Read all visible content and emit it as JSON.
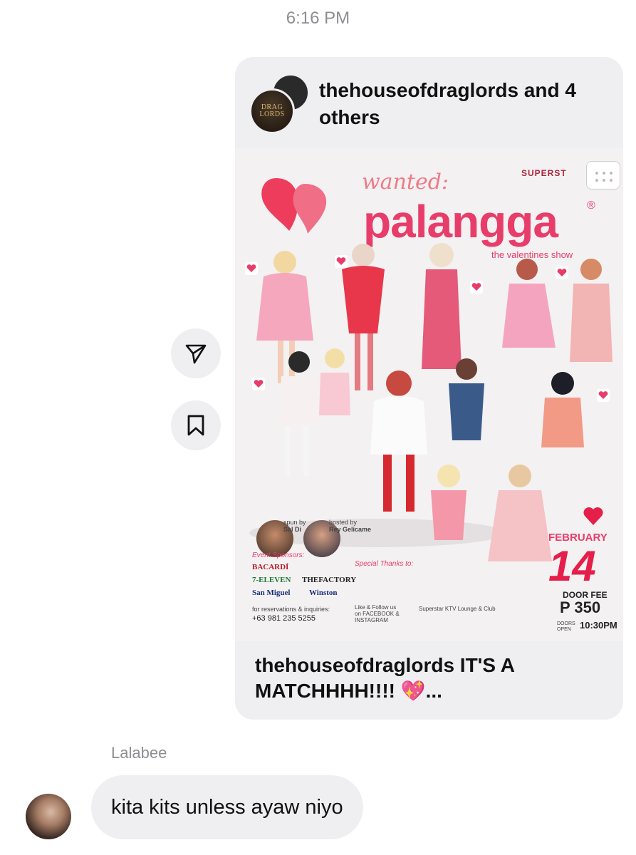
{
  "timestamp": "6:16 PM",
  "post": {
    "author_line": "thehouseofdraglords and 4 others",
    "avatar_text": [
      "DRAG",
      "LORDS"
    ],
    "caption": "thehouseofdraglords IT'S A MATCHHHH!!!! 💖...",
    "poster": {
      "wanted": "wanted:",
      "title": "palangga",
      "reg": "®",
      "subtitle": "the valentines show",
      "venue": "SUPERST",
      "spun_by_label": "spun by",
      "spun_by": "Sal Di",
      "hosted_by_label": "hosted by",
      "hosted_by": "Rey Gelicame",
      "event_sponsors_label": "Event Sponsors:",
      "sponsors": [
        "BACARDÍ",
        "7-ELEVEN",
        "THEFACTORY",
        "San Miguel",
        "Winston"
      ],
      "special_thanks_label": "Special Thanks to:",
      "reservations_label": "for reservations & inquiries:",
      "phone": "+63 981 235 5255",
      "follow_text": "Like & Follow us on FACEBOOK & INSTAGRAM",
      "club_name": "Superstar KTV Lounge & Club",
      "month": "FEBRUARY",
      "day": "14",
      "door_fee_label": "DOOR FEE",
      "price": "P 350",
      "doors_open_label": "DOORS OPEN",
      "time": "10:30PM"
    }
  },
  "actions": {
    "share_icon": "paper-plane-icon",
    "save_icon": "bookmark-icon"
  },
  "message": {
    "sender": "Lalabee",
    "text": "kita kits unless ayaw niyo"
  },
  "colors": {
    "bubble": "#efeff1",
    "accent_pink": "#e83d6a",
    "meta_gray": "#8e8e93"
  }
}
